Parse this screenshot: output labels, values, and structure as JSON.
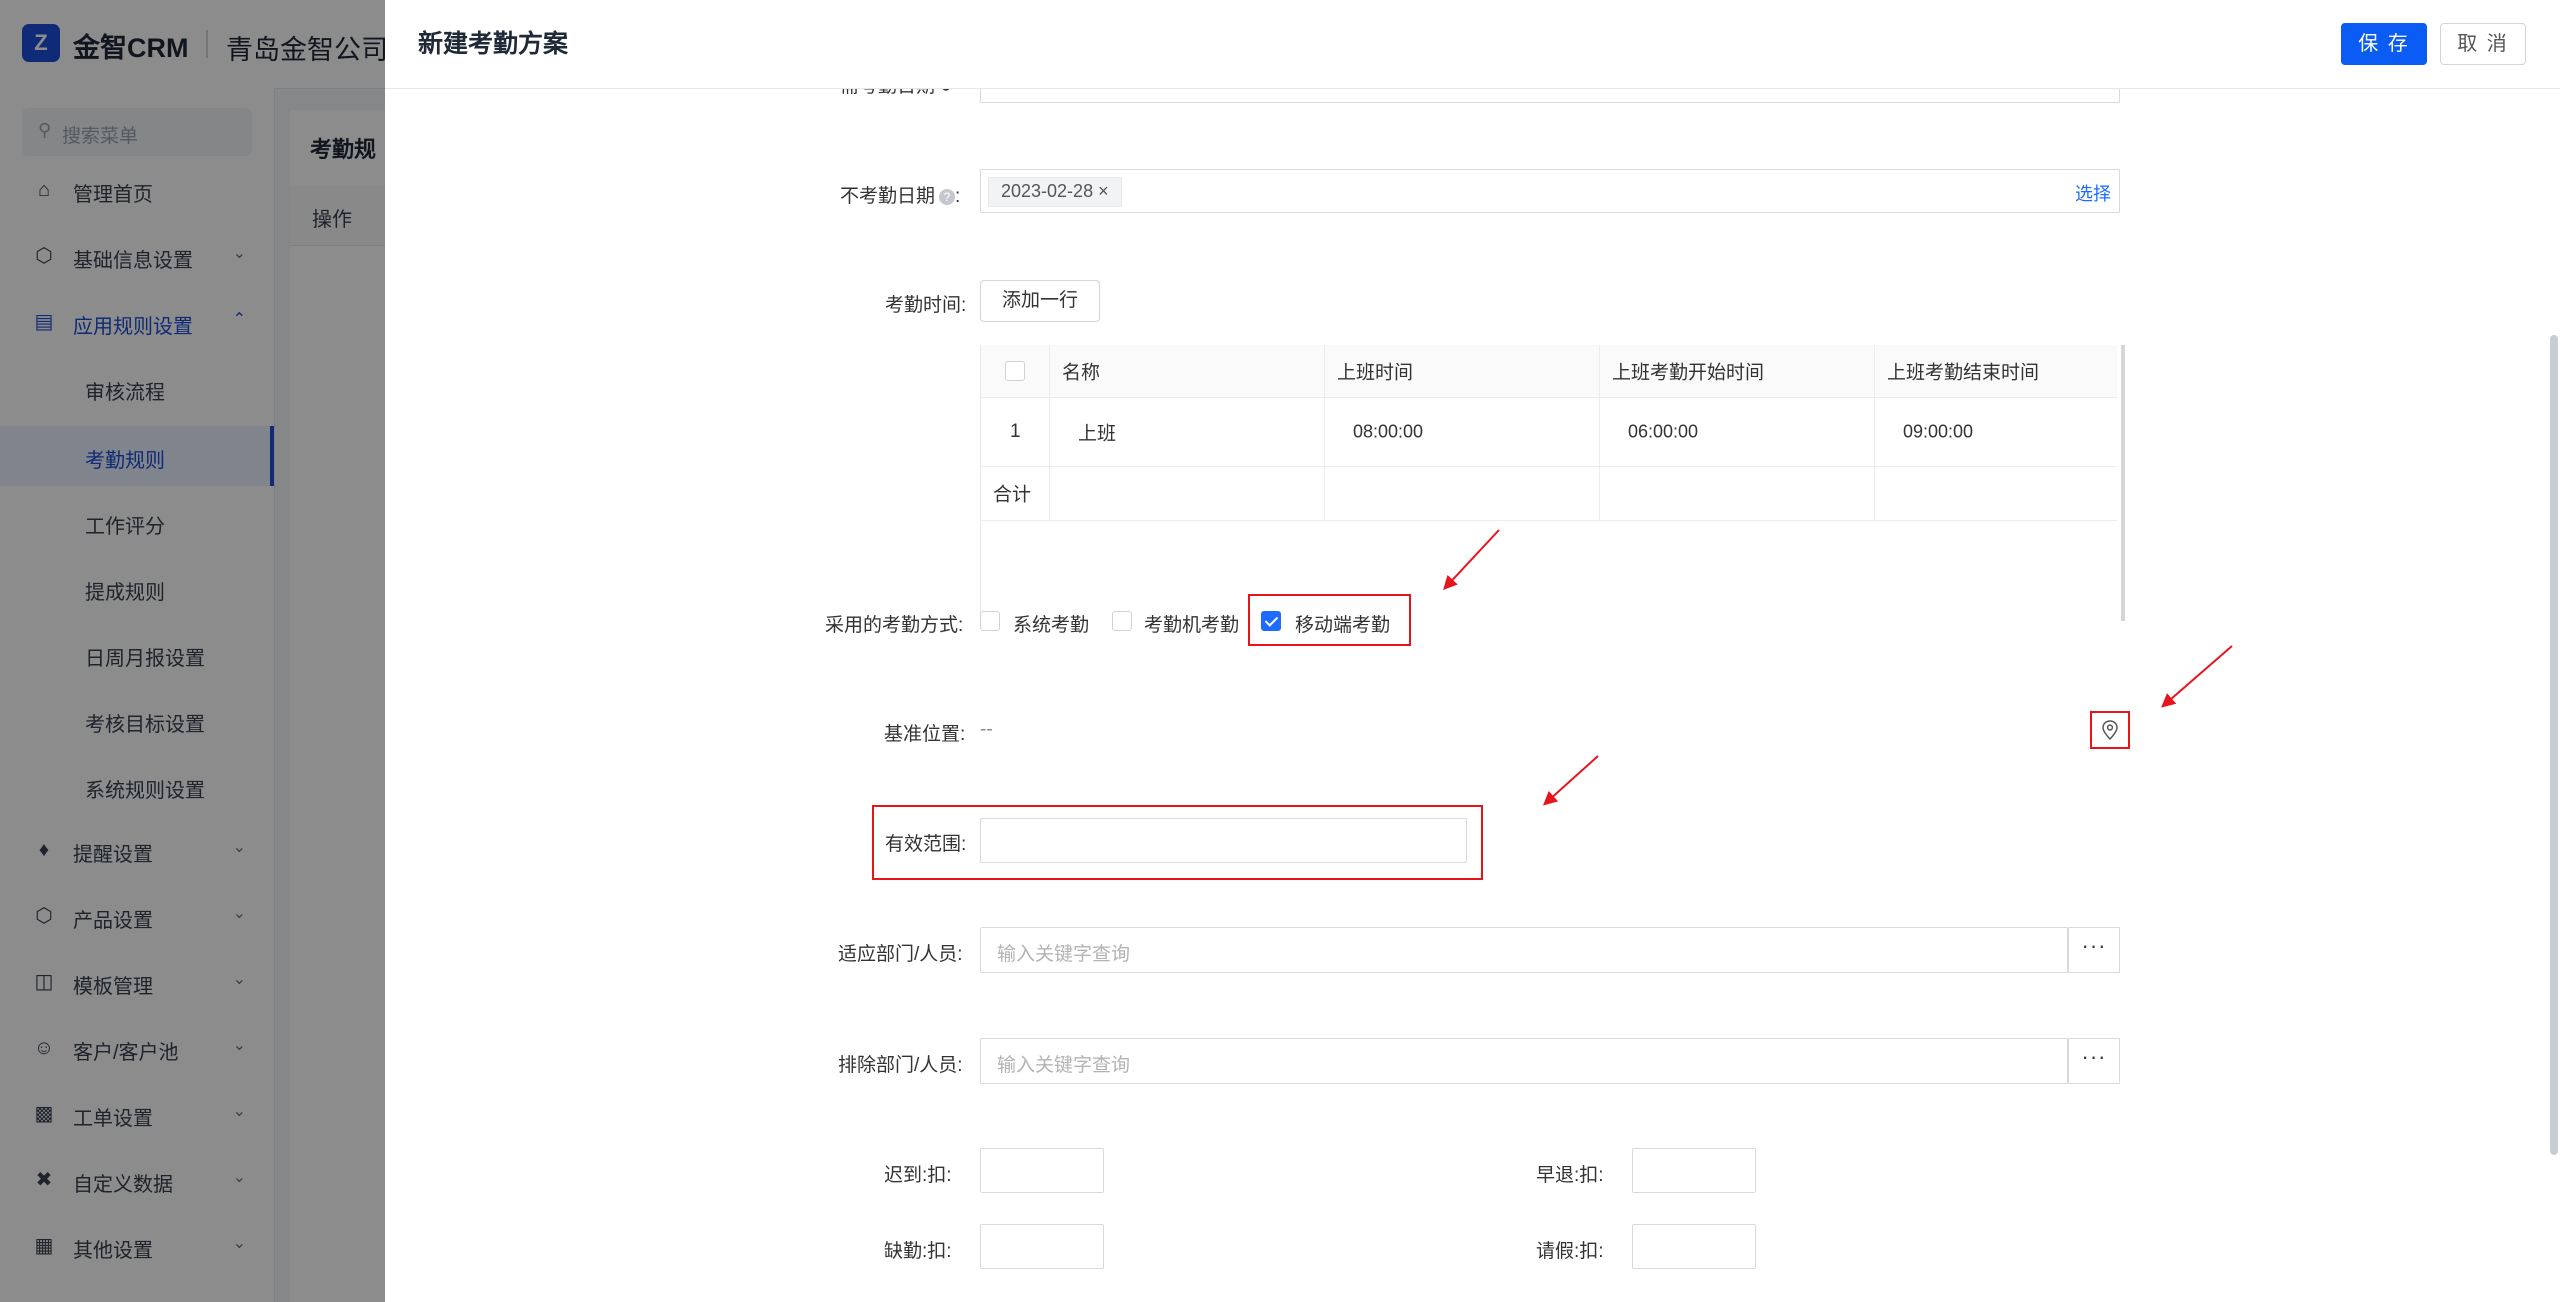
{
  "app": {
    "logo_text": "金智CRM",
    "company": "青岛金智公司"
  },
  "sidebar": {
    "search_placeholder": "搜索菜单",
    "items": [
      {
        "label": "管理首页",
        "icon": "home-icon"
      },
      {
        "label": "基础信息设置",
        "icon": "cube-icon"
      },
      {
        "label": "应用规则设置",
        "icon": "document-icon"
      },
      {
        "label": "提醒设置",
        "icon": "bell-icon"
      },
      {
        "label": "产品设置",
        "icon": "cube-icon"
      },
      {
        "label": "模板管理",
        "icon": "template-icon"
      },
      {
        "label": "客户/客户池",
        "icon": "users-icon"
      },
      {
        "label": "工单设置",
        "icon": "ticket-icon"
      },
      {
        "label": "自定义数据",
        "icon": "tools-icon"
      },
      {
        "label": "其他设置",
        "icon": "grid-icon"
      }
    ],
    "sub_items": [
      "审核流程",
      "考勤规则",
      "工作评分",
      "提成规则",
      "日周月报设置",
      "考核目标设置",
      "系统规则设置"
    ],
    "active_sub": "考勤规则"
  },
  "main": {
    "breadcrumb": "考勤规",
    "table_header": "操作"
  },
  "drawer": {
    "title": "新建考勤方案",
    "save_label": "保 存",
    "cancel_label": "取 消",
    "form": {
      "non_attendance_label": "不考勤日期",
      "non_attendance_tag": "2023-02-28 ×",
      "select_link": "选择",
      "attendance_time_label": "考勤时间:",
      "add_row_label": "添加一行",
      "grid": {
        "columns": [
          "名称",
          "上班时间",
          "上班考勤开始时间",
          "上班考勤结束时间"
        ],
        "rows": [
          {
            "index": "1",
            "name": "上班",
            "start": "08:00:00",
            "check_start": "06:00:00",
            "check_end": "09:00:00"
          }
        ],
        "total_label": "合计"
      },
      "method_label": "采用的考勤方式:",
      "methods": [
        {
          "label": "系统考勤",
          "checked": false
        },
        {
          "label": "考勤机考勤",
          "checked": false
        },
        {
          "label": "移动端考勤",
          "checked": true
        }
      ],
      "base_location_label": "基准位置:",
      "base_location_value": "--",
      "range_label": "有效范围:",
      "range_value": "",
      "apply_label": "适应部门/人员:",
      "apply_placeholder": "输入关键字查询",
      "exclude_label": "排除部门/人员:",
      "exclude_placeholder": "输入关键字查询",
      "more_label": "···",
      "late_label": "迟到:",
      "early_label": "早退:",
      "absent_label": "缺勤:",
      "leave_label": "请假:",
      "deduct_label": "扣:"
    }
  },
  "colors": {
    "primary": "#0a5cf5",
    "annotation": "#e8141b"
  }
}
